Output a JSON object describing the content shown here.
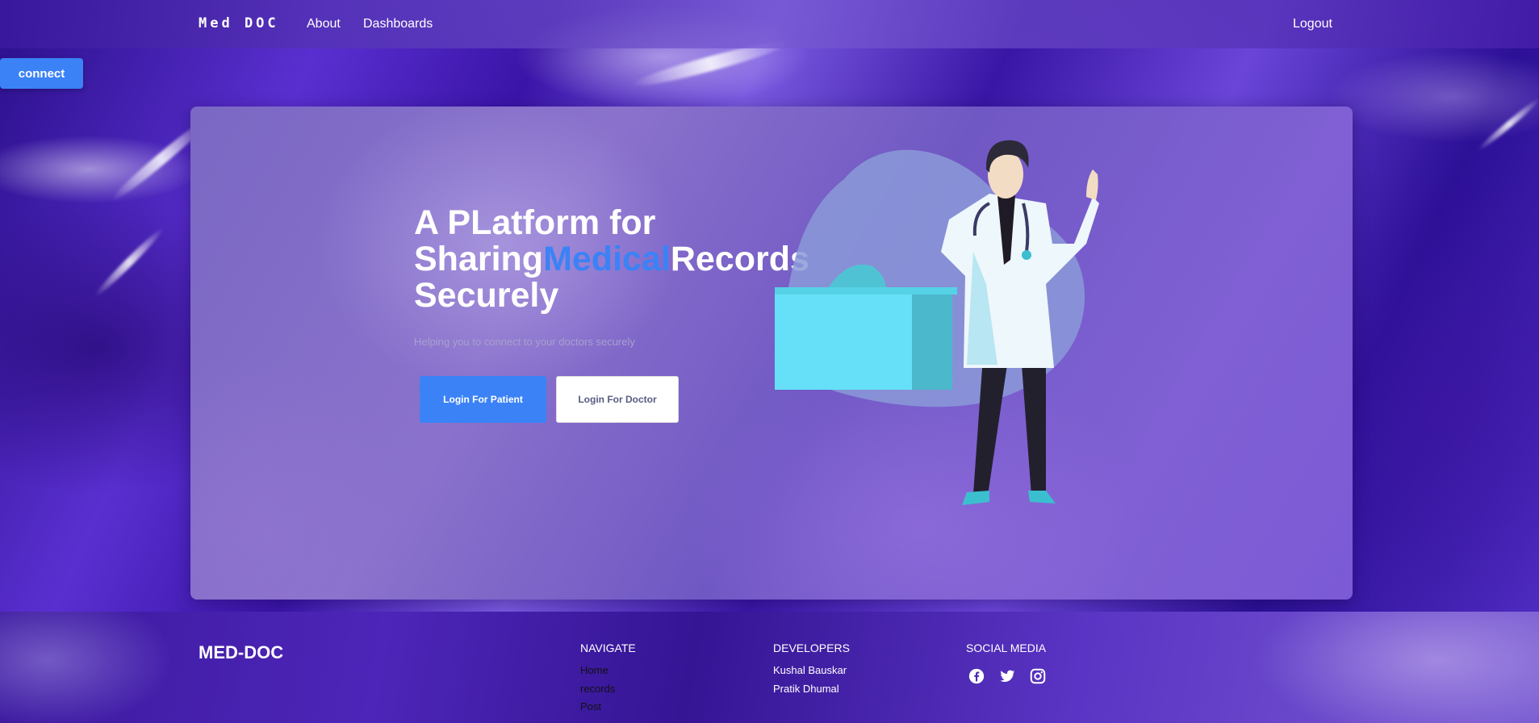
{
  "nav": {
    "brand": "Med DOC",
    "about": "About",
    "dashboards": "Dashboards",
    "logout": "Logout"
  },
  "connect_button": "connect",
  "hero": {
    "title_part1": "A PLatform for",
    "title_part2": "Sharing",
    "title_accent": "Medical",
    "title_part3": "Records",
    "title_part4": "Securely",
    "subtitle": "Helping you to connect to your doctors securely",
    "login_patient": "Login For Patient",
    "login_doctor": "Login For Doctor"
  },
  "footer": {
    "brand": "MED-DOC",
    "navigate": {
      "title": "NAVIGATE",
      "links": [
        "Home",
        "records",
        "Post"
      ]
    },
    "developers": {
      "title": "DEVELOPERS",
      "names": [
        "Kushal Bauskar",
        "Pratik Dhumal"
      ]
    },
    "social": {
      "title": "SOCIAL MEDIA",
      "icons": [
        "facebook-icon",
        "twitter-icon",
        "instagram-icon"
      ]
    }
  },
  "colors": {
    "accent": "#3b82f6",
    "text_light": "#ffffff",
    "subtitle": "#a7a0cf"
  }
}
